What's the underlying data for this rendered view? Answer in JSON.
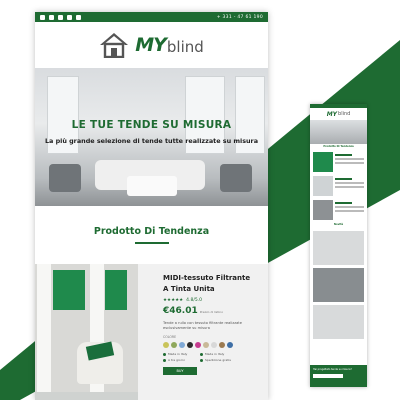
{
  "colors": {
    "brand_green": "#1e6b32",
    "swatch_colors": [
      "#c9c45a",
      "#8fa85c",
      "#7fa9d6",
      "#2a2a2a",
      "#c63b8f",
      "#c9b998",
      "#d8d8d8",
      "#9c7a50",
      "#3f6fa6"
    ]
  },
  "topbar": {
    "phone": "+ 331 - 47 61 190",
    "social_icons": [
      "facebook-icon",
      "twitter-icon",
      "instagram-icon",
      "youtube-icon",
      "linkedin-icon"
    ]
  },
  "brand": {
    "logo_my": "MY",
    "logo_blind": "blind"
  },
  "hero": {
    "title": "LE TUE TENDE SU MISURA",
    "subtitle": "La più grande selezione di tende tutte realizzate su misura"
  },
  "trend": {
    "title": "Prodotto Di Tendenza"
  },
  "product": {
    "name_line1": "MIDI-tessuto Filtrante",
    "name_line2": "A Tinta Unita",
    "stars": "★★★★★",
    "rating": "4.8/5.0",
    "price": "€46.01",
    "price_note": "Prezzo di listino",
    "description": "Tende a rullo con tessuto filtrante realizzate esclusivamente su misura",
    "colors_label": "COLORE",
    "options": [
      "Made in Italy",
      "Made in Italy",
      "A tre giorni",
      "Spedizione gratis"
    ],
    "buy_label": "BUY"
  },
  "mobile": {
    "logo_my": "MY",
    "logo_blind": "blind",
    "section_trend": "Prodotto Di Tendenza",
    "section_new": "Novità",
    "footer_text": "Hai progettato tende su misura?"
  }
}
